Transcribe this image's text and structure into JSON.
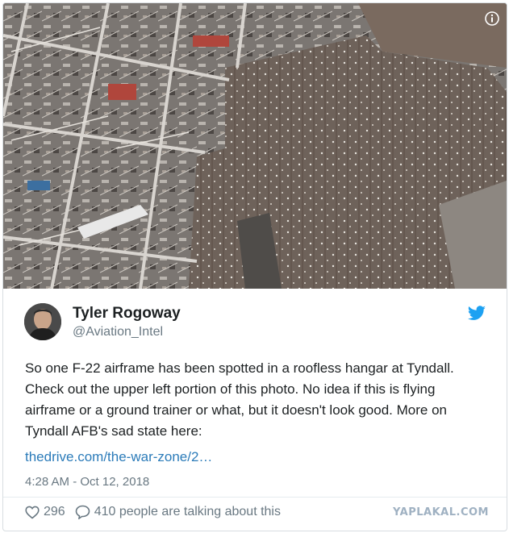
{
  "tweet": {
    "author_name": "Tyler Rogoway",
    "handle": "@Aviation_Intel",
    "text": "So one F-22 airframe has been spotted in a roofless hangar at Tyndall. Check out the upper left portion of this photo. No idea if this is flying airframe or a ground trainer or what, but it doesn't look good. More on Tyndall AFB's sad state here:",
    "link_text": "thedrive.com/the-war-zone/2…",
    "timestamp": "4:28 AM - Oct 12, 2018",
    "like_count": "296",
    "conversation_text": "410 people are talking about this"
  },
  "watermark": "YAPLAKAL.COM",
  "icons": {
    "info": "info-icon",
    "bird": "twitter-bird-icon",
    "like": "heart-icon",
    "reply": "speech-bubble-icon"
  },
  "colors": {
    "link": "#2b7bb9",
    "twitter_blue": "#1da1f2",
    "secondary_text": "#697882"
  }
}
